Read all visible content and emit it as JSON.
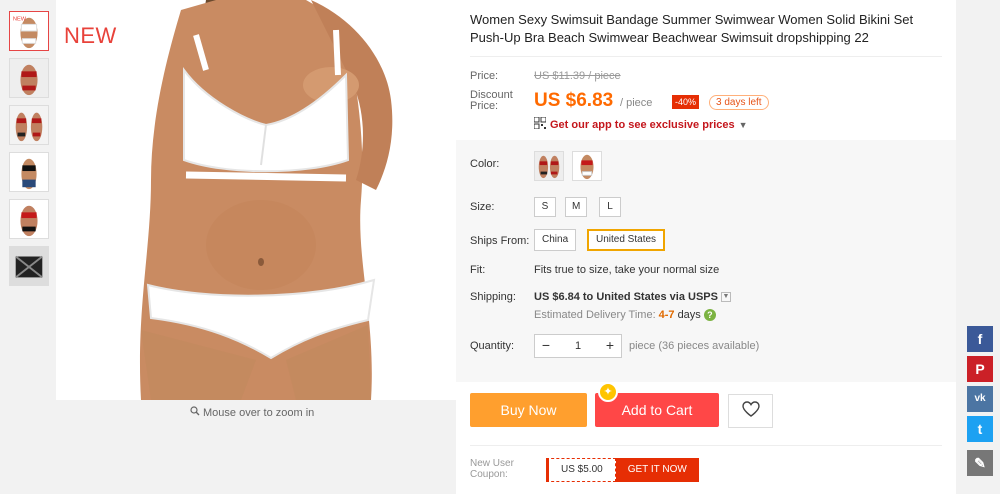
{
  "gallery": {
    "new_badge": "NEW",
    "zoom_hint": "Mouse over to zoom in",
    "thumbnails": [
      "white-bikini",
      "red-bikini",
      "red-bikini-pair",
      "black-bikini",
      "red-black-bikini",
      "black-pattern-bikini"
    ]
  },
  "product": {
    "title": "Women Sexy Swimsuit Bandage Summer Swimwear Women Solid Bikini Set Push-Up Bra Beach Swimwear Beachwear Swimsuit dropshipping 22"
  },
  "price": {
    "price_label": "Price:",
    "original": "US $11.39 / piece",
    "discount_label": "Discount Price:",
    "current": "US $6.83",
    "per_unit": "/ piece",
    "discount_badge": "-40%",
    "days_left": "3 days left",
    "app_promo": "Get our app to see exclusive prices"
  },
  "options": {
    "color_label": "Color:",
    "colors": [
      "red-black",
      "red-white"
    ],
    "size_label": "Size:",
    "sizes": [
      "S",
      "M",
      "L"
    ],
    "ships_from_label": "Ships From:",
    "ships_from": [
      "China",
      "United States"
    ],
    "ships_from_selected": "United States",
    "fit_label": "Fit:",
    "fit_value": "Fits true to size, take your normal size",
    "shipping_label": "Shipping:",
    "shipping_price": "US $6.84",
    "shipping_to": "to United States via USPS",
    "delivery_label": "Estimated Delivery Time:",
    "delivery_days": "4-7",
    "delivery_unit": "days",
    "quantity_label": "Quantity:",
    "quantity_value": "1",
    "quantity_note": "piece (36 pieces available)"
  },
  "actions": {
    "buy_now": "Buy Now",
    "add_to_cart": "Add to Cart"
  },
  "coupon": {
    "label": "New User Coupon:",
    "amount": "US $5.00",
    "cta": "GET IT NOW"
  },
  "social": {
    "facebook": "f",
    "pinterest": "P",
    "vk": "vk",
    "twitter": "t"
  },
  "colors": {
    "accent_orange": "#ff6a00",
    "cart_red": "#ff4747",
    "buy_orange": "#ff9f2e",
    "badge_red": "#e62e04"
  }
}
